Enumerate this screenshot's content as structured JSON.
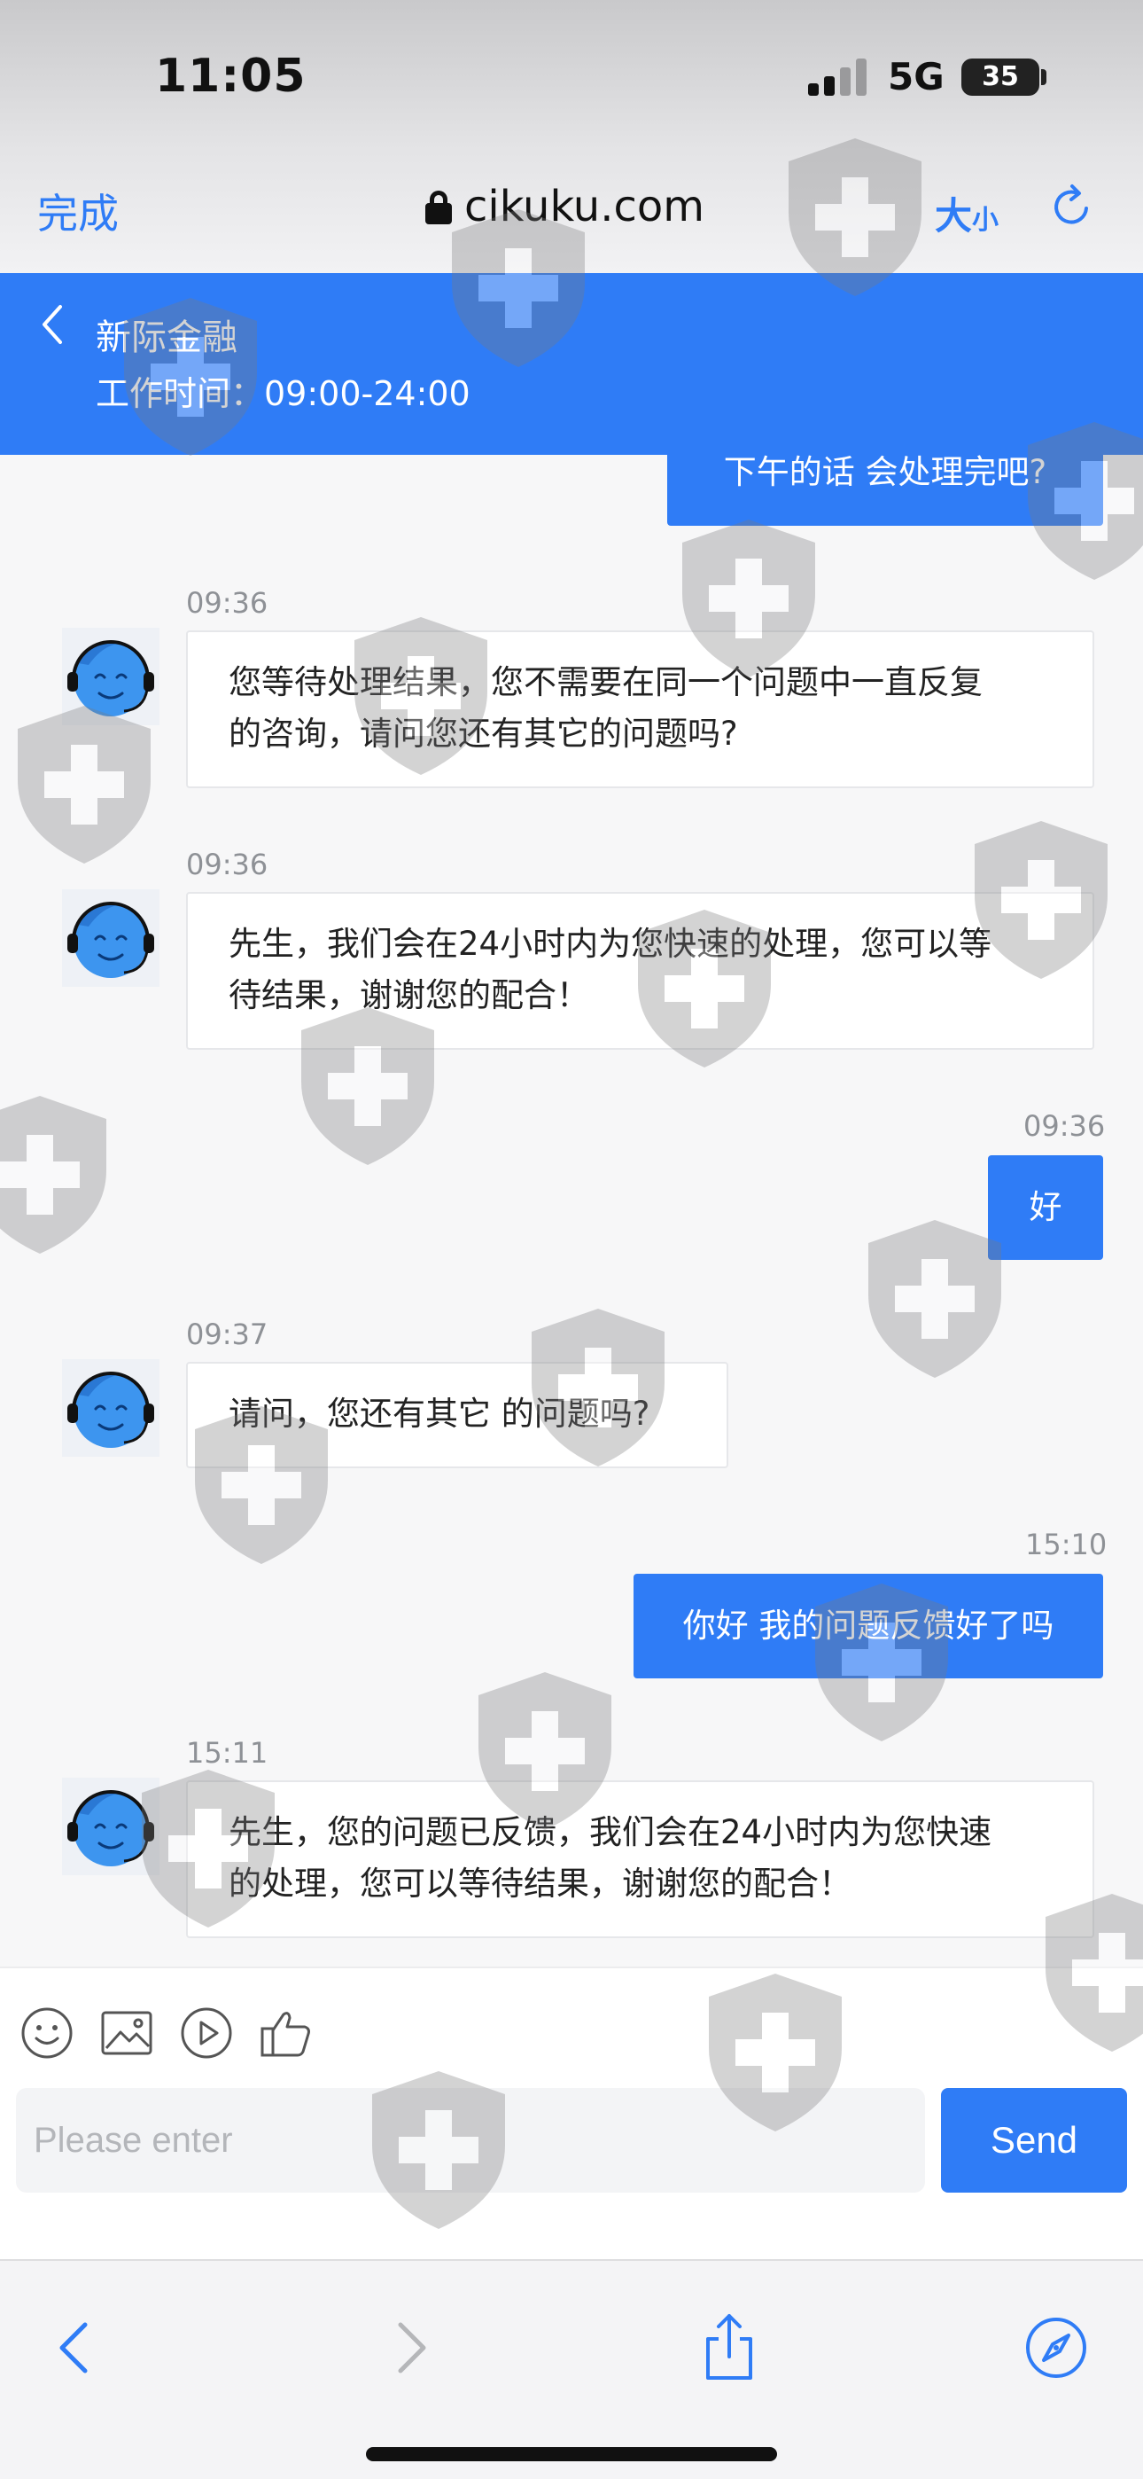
{
  "status_bar": {
    "time": "11:05",
    "network": "5G",
    "battery": "35"
  },
  "browser": {
    "done_label": "完成",
    "url": "cikuku.com",
    "text_size_large": "大",
    "text_size_small": "小"
  },
  "chat": {
    "title": "新际金融",
    "hours": "工作时间：09:00-24:00"
  },
  "messages": [
    {
      "side": "out",
      "time": "",
      "text": "下午的话 会处理完吧?"
    },
    {
      "side": "in",
      "time": "09:36",
      "lines": [
        "您等待处理结果，您不需要在同一个问题中一直反复",
        "的咨询，请问您还有其它的问题吗?"
      ]
    },
    {
      "side": "in",
      "time": "09:36",
      "lines": [
        "先生，我们会在24小时内为您快速的处理，您可以等",
        "待结果，谢谢您的配合！"
      ]
    },
    {
      "side": "out",
      "time": "09:36",
      "text": "好"
    },
    {
      "side": "in",
      "time": "09:37",
      "lines": [
        "请问，您还有其它 的问题吗?"
      ]
    },
    {
      "side": "out",
      "time": "15:10",
      "text": "你好 我的问题反馈好了吗"
    },
    {
      "side": "in",
      "time": "15:11",
      "lines": [
        "先生，您的问题已反馈，我们会在24小时内为您快速",
        "的处理，您可以等待结果，谢谢您的配合！"
      ]
    }
  ],
  "input": {
    "placeholder": "Please enter",
    "value": "",
    "send_label": "Send"
  },
  "toolbar_icons": [
    "emoji-icon",
    "image-icon",
    "video-icon",
    "thumbs-up-icon"
  ],
  "colors": {
    "accent": "#2f7cf6",
    "incoming_bubble": "#ffffff",
    "background": "#f7f7f8"
  }
}
